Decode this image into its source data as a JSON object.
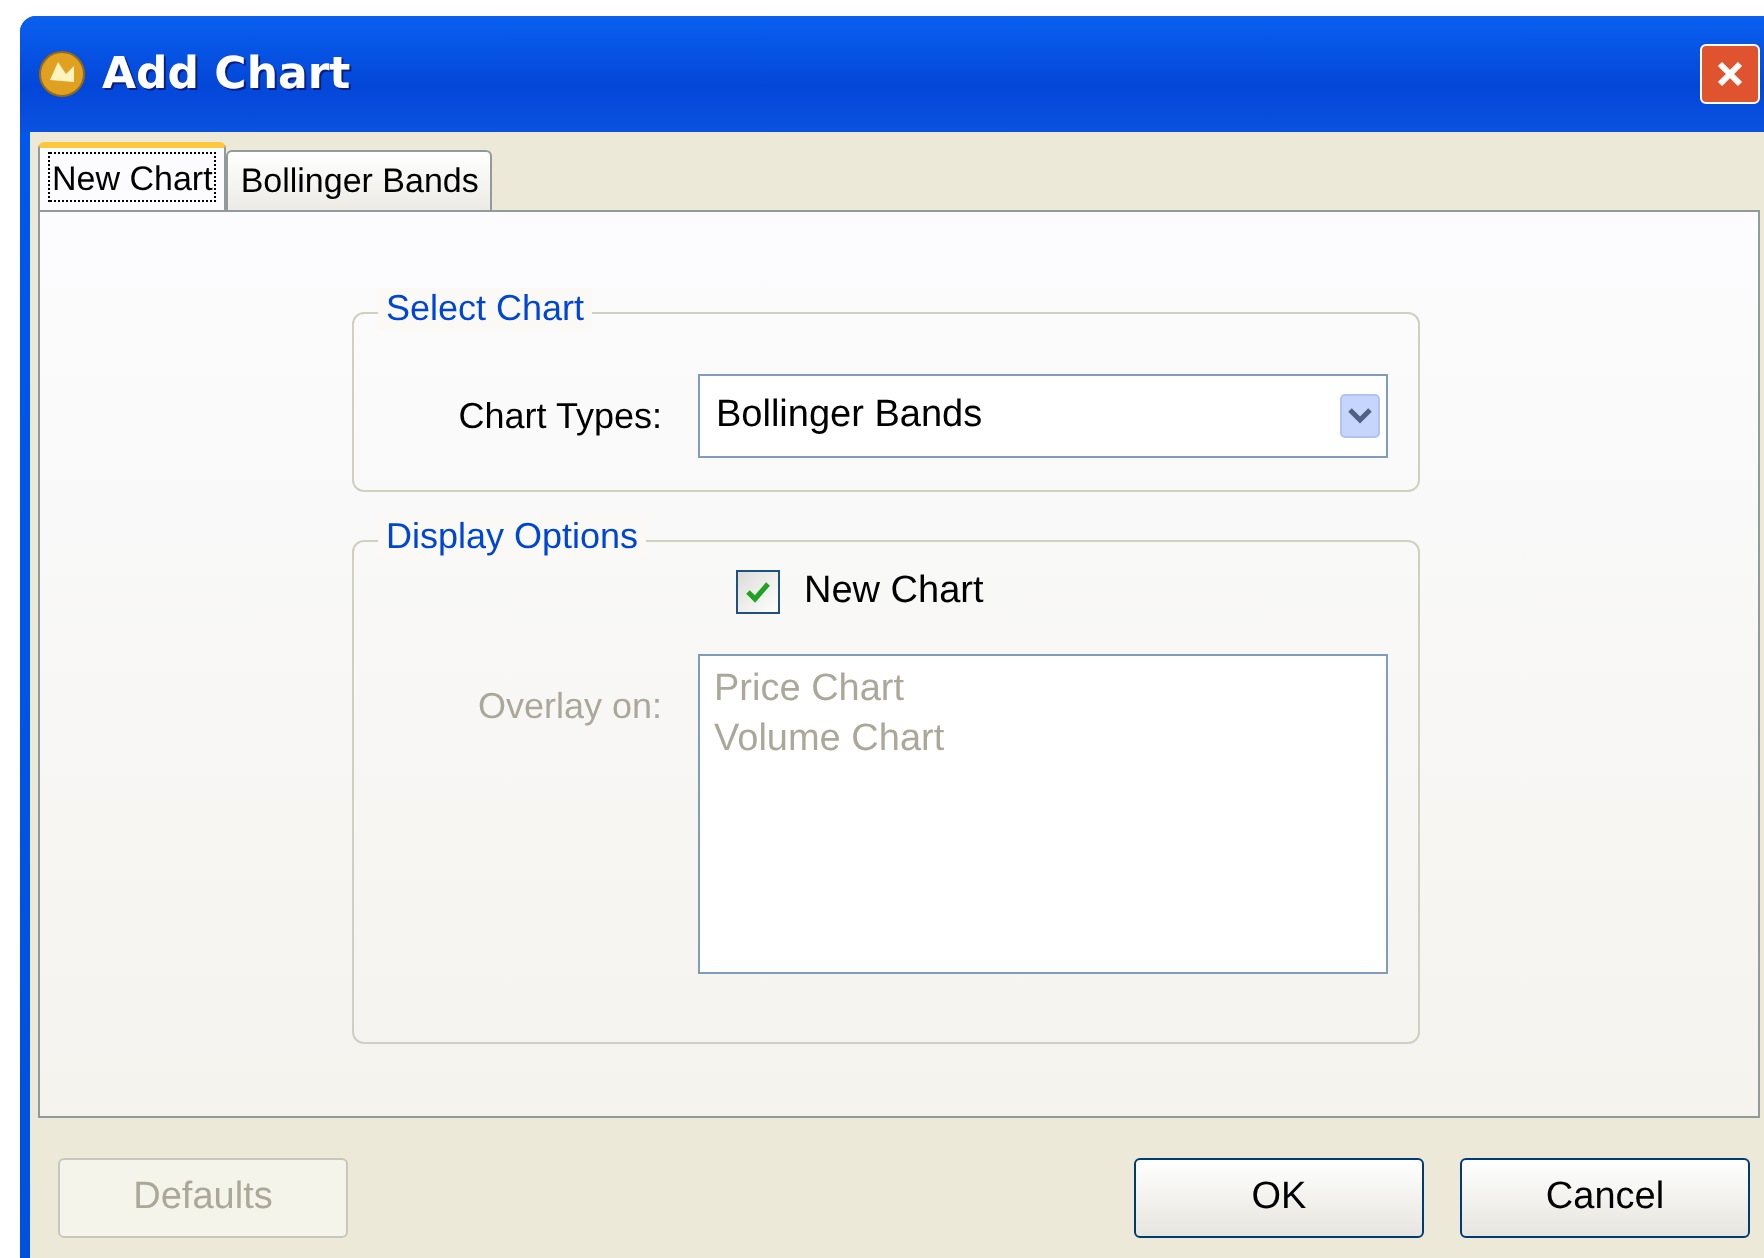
{
  "window": {
    "title": "Add Chart"
  },
  "tabs": [
    {
      "label": "New Chart",
      "selected": true
    },
    {
      "label": "Bollinger Bands",
      "selected": false
    }
  ],
  "select_chart": {
    "legend": "Select Chart",
    "label": "Chart Types:",
    "value": "Bollinger Bands"
  },
  "display_options": {
    "legend": "Display Options",
    "checkbox": {
      "label": "New Chart",
      "checked": true
    },
    "overlay_label": "Overlay on:",
    "overlay_disabled": true,
    "overlay_items": [
      "Price Chart",
      "Volume Chart"
    ]
  },
  "buttons": [
    {
      "label": "Defaults",
      "disabled": true
    },
    {
      "label": "OK",
      "disabled": false
    },
    {
      "label": "Cancel",
      "disabled": false
    }
  ]
}
